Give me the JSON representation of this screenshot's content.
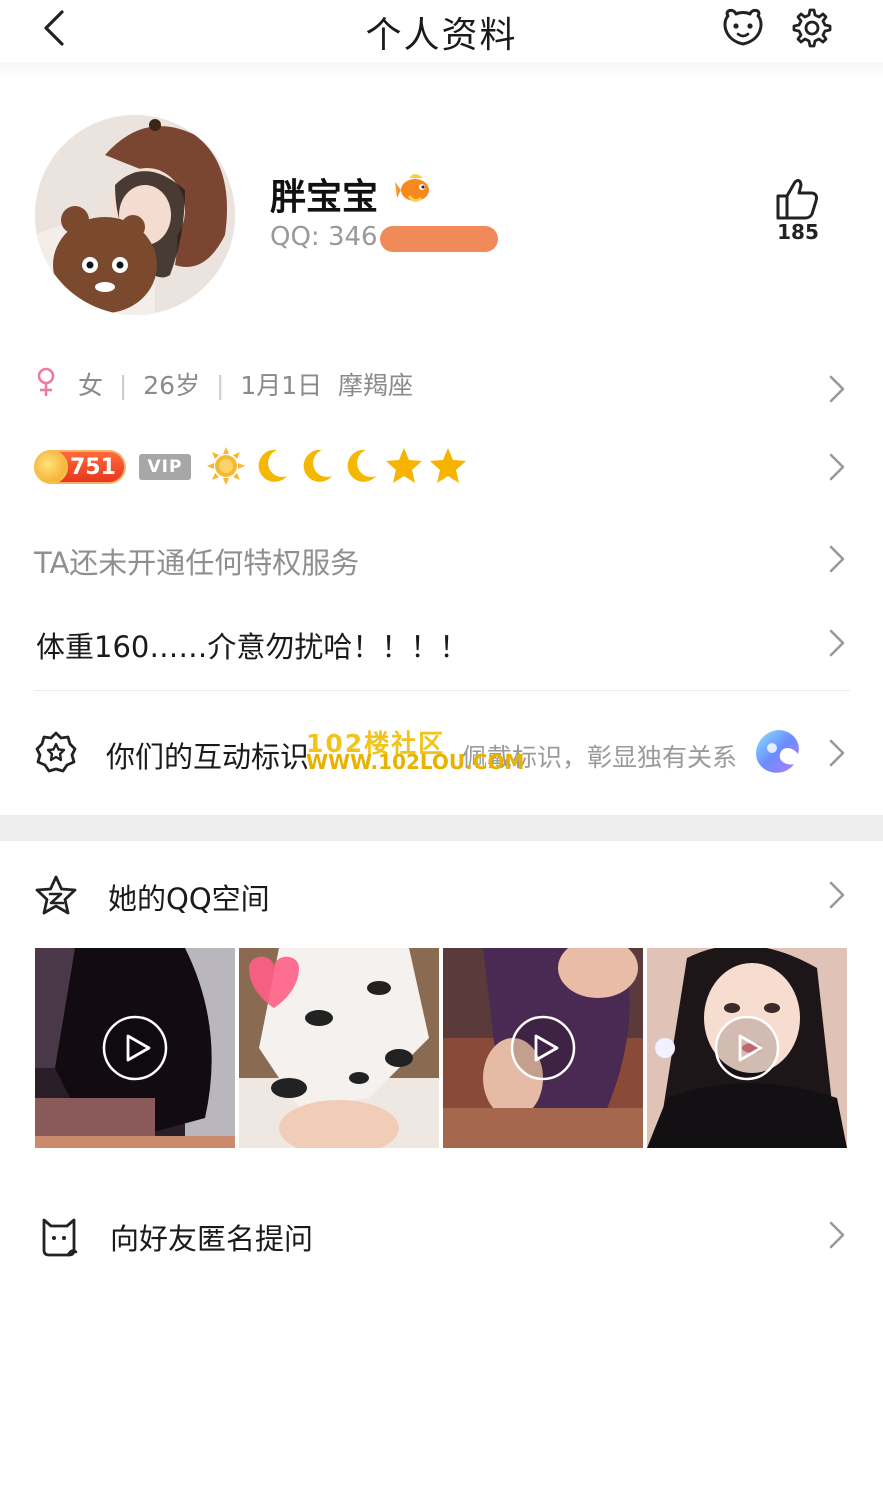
{
  "header": {
    "title": "个人资料",
    "back_icon": "chevron-left-icon",
    "pet_icon": "pet-icon",
    "settings_icon": "gear-icon"
  },
  "profile": {
    "name": "胖宝宝",
    "qq_label": "QQ:",
    "qq_prefix": "346",
    "like_count": "185"
  },
  "info": {
    "gender": "女",
    "age": "26岁",
    "birthday": "1月1日",
    "zodiac": "摩羯座",
    "separator": "|"
  },
  "badges": {
    "level": "751",
    "vip": "VIP",
    "level_icons": [
      "sun",
      "moon",
      "moon",
      "moon",
      "star",
      "star"
    ],
    "colors": {
      "sun": "#f7b731",
      "moon": "#f5b800",
      "star": "#f6b400"
    }
  },
  "privilege_text": "TA还未开通任何特权服务",
  "signature": "体重160……介意勿扰哈！！！！",
  "interaction": {
    "label": "你们的互动标识",
    "hint": "佩戴标识，彰显独有关系"
  },
  "watermark": {
    "line1": "102楼社区",
    "line2": "WWW.102LOU.COM"
  },
  "qzone": {
    "label": "她的QQ空间",
    "thumbs": [
      {
        "kind": "video"
      },
      {
        "kind": "photo"
      },
      {
        "kind": "video"
      },
      {
        "kind": "video"
      }
    ]
  },
  "ask": {
    "label": "向好友匿名提问"
  }
}
